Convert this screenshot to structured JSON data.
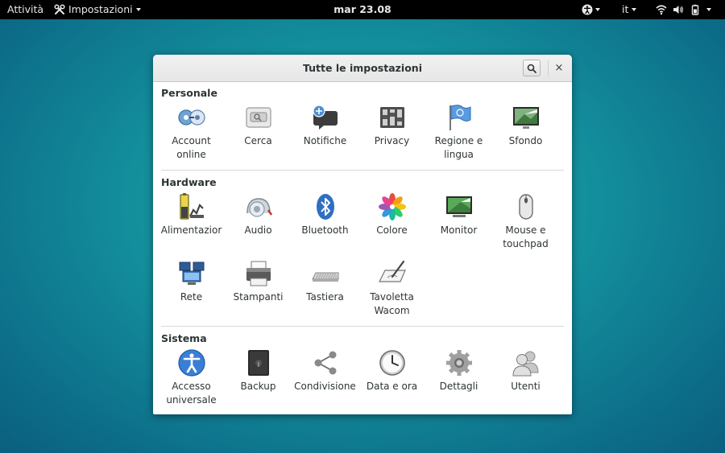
{
  "topbar": {
    "activities": "Attività",
    "app_menu": "Impostazioni",
    "clock": "mar 23.08",
    "language": "it"
  },
  "window": {
    "title": "Tutte le impostazioni",
    "close_glyph": "×"
  },
  "sections": {
    "personale": {
      "title": "Personale",
      "items": [
        "Account\nonline",
        "Cerca",
        "Notifiche",
        "Privacy",
        "Regione e\nlingua",
        "Sfondo"
      ]
    },
    "hardware": {
      "title": "Hardware",
      "items": [
        "Alimentazior",
        "Audio",
        "Bluetooth",
        "Colore",
        "Monitor",
        "Mouse e\ntouchpad",
        "Rete",
        "Stampanti",
        "Tastiera",
        "Tavoletta\nWacom"
      ]
    },
    "sistema": {
      "title": "Sistema",
      "items": [
        "Accesso\nuniversale",
        "Backup",
        "Condivisione",
        "Data e ora",
        "Dettagli",
        "Utenti"
      ]
    }
  },
  "icons": {
    "personale": [
      "online-accounts-icon",
      "search-icon",
      "notifications-icon",
      "privacy-icon",
      "region-language-icon",
      "background-icon"
    ],
    "hardware": [
      "power-icon",
      "sound-icon",
      "bluetooth-icon",
      "color-icon",
      "display-icon",
      "mouse-icon",
      "network-icon",
      "printer-icon",
      "keyboard-icon",
      "wacom-tablet-icon"
    ],
    "sistema": [
      "universal-access-icon",
      "backup-icon",
      "sharing-icon",
      "date-time-icon",
      "details-icon",
      "users-icon"
    ]
  },
  "colors": {
    "topbar": "#000000",
    "desktop": "#138f9c",
    "window_bg": "#ffffff",
    "accent_blue": "#3a7fd5"
  }
}
